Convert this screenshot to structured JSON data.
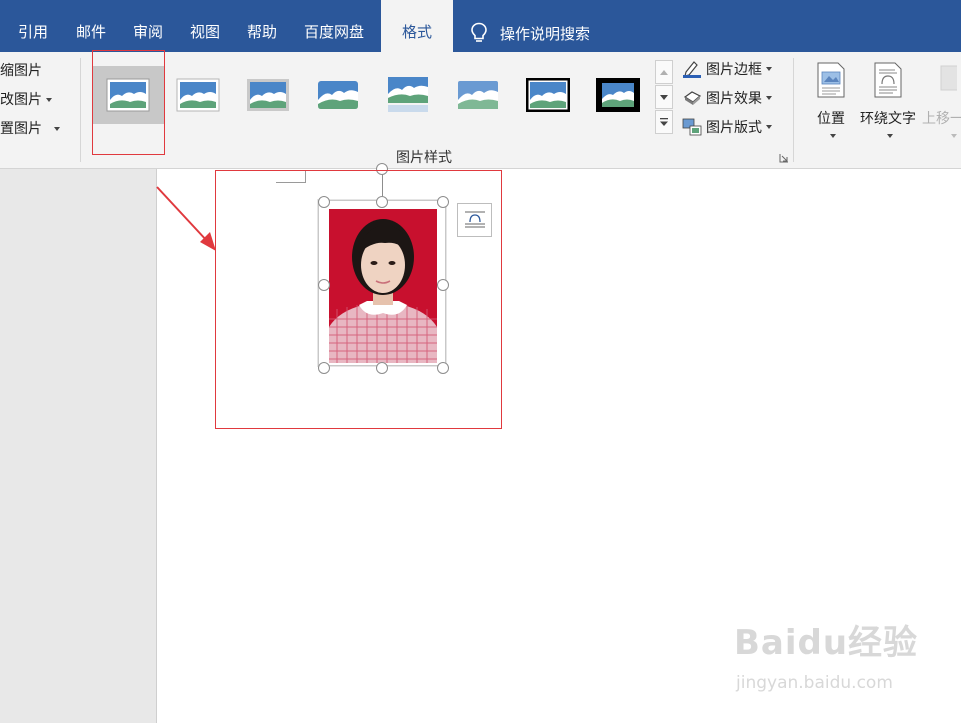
{
  "tabs": [
    {
      "label": "引用",
      "active": false
    },
    {
      "label": "邮件",
      "active": false
    },
    {
      "label": "审阅",
      "active": false
    },
    {
      "label": "视图",
      "active": false
    },
    {
      "label": "帮助",
      "active": false
    },
    {
      "label": "百度网盘",
      "active": false
    },
    {
      "label": "格式",
      "active": true
    }
  ],
  "search": {
    "label": "操作说明搜索",
    "icon": "lightbulb-icon"
  },
  "adjust": {
    "items": [
      "缩图片",
      "改图片",
      "置图片"
    ]
  },
  "picture_styles": {
    "group_label": "图片样式",
    "gallery_count": 8,
    "selected_index": 0,
    "commands": [
      {
        "label": "图片边框",
        "icon": "picture-border-icon"
      },
      {
        "label": "图片效果",
        "icon": "picture-effects-icon"
      },
      {
        "label": "图片版式",
        "icon": "picture-layout-icon"
      }
    ]
  },
  "arrange": {
    "position_label": "位置",
    "wrap_label": "环绕文字",
    "forward_label": "上移一"
  },
  "watermark": {
    "logo": "Baidu经验",
    "url": "jingyan.baidu.com"
  },
  "colors": {
    "ribbon_blue": "#2b579a",
    "annotation_red": "#e0393e",
    "photo_background_red": "#c8102e"
  }
}
